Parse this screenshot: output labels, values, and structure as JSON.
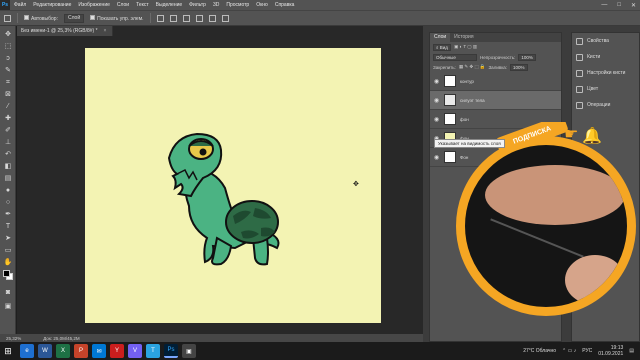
{
  "app": {
    "logo": "Ps",
    "menu": [
      "Файл",
      "Редактирование",
      "Изображение",
      "Слои",
      "Текст",
      "Выделение",
      "Фильтр",
      "3D",
      "Просмотр",
      "Окно",
      "Справка"
    ],
    "window_controls": [
      "—",
      "□",
      "✕"
    ]
  },
  "options_bar": {
    "autoselect_label": "Автовыбор:",
    "autoselect_value": "Слой",
    "show_transform_label": "Показать упр. элем."
  },
  "document": {
    "tab_title": "Без имени-1 @ 25,3% (RGB/8#) *",
    "tab_close": "×",
    "zoom": "25,32%",
    "doc_size": "Док: 25,0М/45,2М"
  },
  "layers_panel": {
    "tabs": [
      "Слои",
      "История"
    ],
    "kind_label": "Вид",
    "blend_mode": "Обычные",
    "opacity_label": "Непрозрачность:",
    "opacity_value": "100%",
    "lock_label": "Закрепить:",
    "fill_label": "Заливка:",
    "fill_value": "100%",
    "tooltip": "Указывает на видимость слоя",
    "layers": [
      {
        "name": "контур",
        "selected": false,
        "thumb": "#ffffff"
      },
      {
        "name": "силуэт тела",
        "selected": true,
        "thumb": "#e8e8e8"
      },
      {
        "name": "фон",
        "selected": false,
        "thumb": "#ffffff"
      },
      {
        "name": "фон",
        "selected": false,
        "thumb": "#f3f3b3"
      },
      {
        "name": "Фон",
        "selected": false,
        "thumb": "#ffffff"
      }
    ]
  },
  "props_panel": {
    "items": [
      "Свойства",
      "Кисти",
      "Настройки кисти",
      "Цвет",
      "Операции"
    ]
  },
  "overlay": {
    "subscribe_label": "ПОДПИСКА"
  },
  "taskbar": {
    "apps": [
      "e",
      "W",
      "X",
      "P",
      "✉",
      "Y",
      "V",
      "T",
      "Ps",
      "▣"
    ],
    "weather": "27°C  Облачно",
    "language": "РУС",
    "time": "19:13",
    "date": "01.09.2021"
  },
  "colors": {
    "canvas": "#f3f3b3",
    "turtle_skin": "#4bb383",
    "turtle_shell": "#2e6b46",
    "accent": "#f5a623"
  }
}
